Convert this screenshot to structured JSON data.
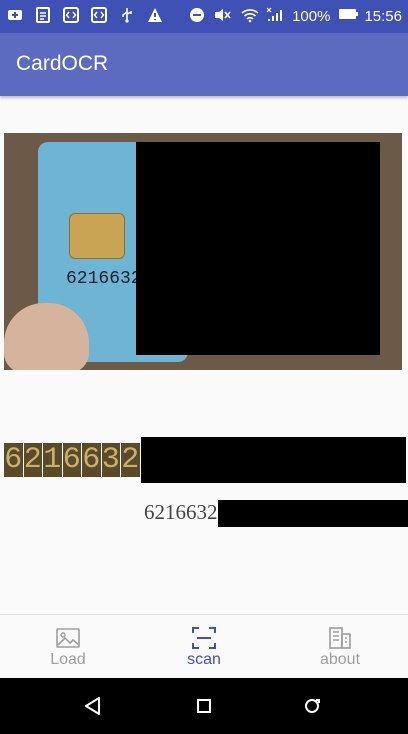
{
  "status_bar": {
    "battery_percent": "100%",
    "time": "15:56",
    "icons": [
      "add-notification-icon",
      "document-icon",
      "code-icon",
      "code-icon",
      "usb-icon",
      "warning-icon",
      "do-not-disturb-icon",
      "mute-icon",
      "wifi-icon",
      "signal-icon",
      "battery-icon"
    ]
  },
  "app_bar": {
    "title": "CardOCR"
  },
  "preview": {
    "card_number_partial": "6216632"
  },
  "ocr": {
    "digits": [
      "6",
      "2",
      "1",
      "6",
      "6",
      "3",
      "2"
    ]
  },
  "result": {
    "text": "6216632"
  },
  "bottom_nav": {
    "items": [
      {
        "label": "Load",
        "icon": "image-icon",
        "active": false
      },
      {
        "label": "scan",
        "icon": "scan-icon",
        "active": true
      },
      {
        "label": "about",
        "icon": "building-icon",
        "active": false
      }
    ]
  },
  "colors": {
    "primary": "#5c6bc0",
    "primary_dark": "#3f51b5",
    "nav_inactive": "#9e9e9e"
  },
  "system_nav": {
    "icons": [
      "back-icon",
      "home-icon",
      "recents-icon"
    ]
  }
}
